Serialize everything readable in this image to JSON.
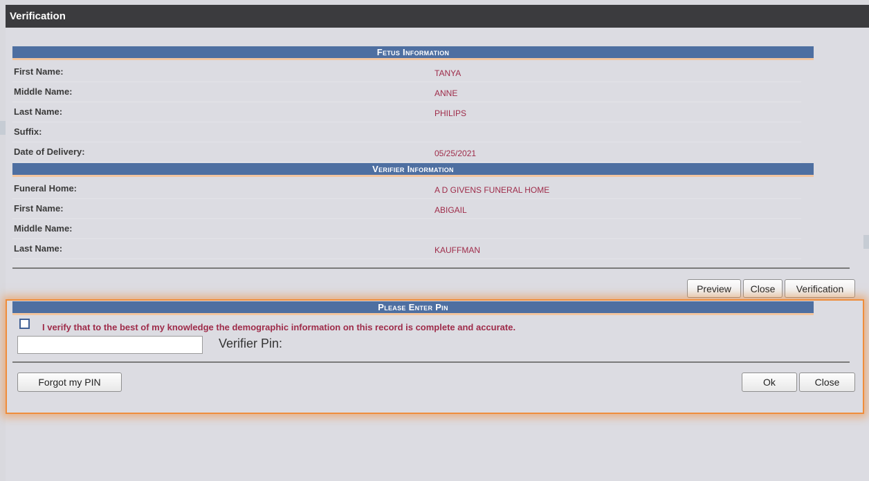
{
  "window": {
    "title": "Verification"
  },
  "fetus": {
    "header": "Fetus Information",
    "rows": [
      {
        "label": "First Name:",
        "value": "TANYA"
      },
      {
        "label": "Middle Name:",
        "value": "ANNE"
      },
      {
        "label": "Last Name:",
        "value": "PHILIPS"
      },
      {
        "label": "Suffix:",
        "value": ""
      },
      {
        "label": "Date of Delivery:",
        "value": "05/25/2021"
      }
    ]
  },
  "verifier": {
    "header": "Verifier Information",
    "rows": [
      {
        "label": "Funeral Home:",
        "value": "A D GIVENS FUNERAL HOME"
      },
      {
        "label": "First Name:",
        "value": "ABIGAIL"
      },
      {
        "label": "Middle Name:",
        "value": ""
      },
      {
        "label": "Last Name:",
        "value": "KAUFFMAN"
      }
    ]
  },
  "actions": {
    "preview": "Preview",
    "close": "Close",
    "verification": "Verification"
  },
  "pin": {
    "header": "Please Enter Pin",
    "checkbox_checked": false,
    "verify_text": "I verify that to the best of my knowledge the demographic information on this record is complete and accurate.",
    "input_value": "",
    "label": "Verifier Pin:",
    "forgot": "Forgot my PIN",
    "ok": "Ok",
    "close": "Close"
  },
  "colors": {
    "header_bg": "#4e6fa1",
    "value_text": "#9e2b49",
    "highlight": "#ef8d3b",
    "titlebar": "#3b3b3e"
  }
}
